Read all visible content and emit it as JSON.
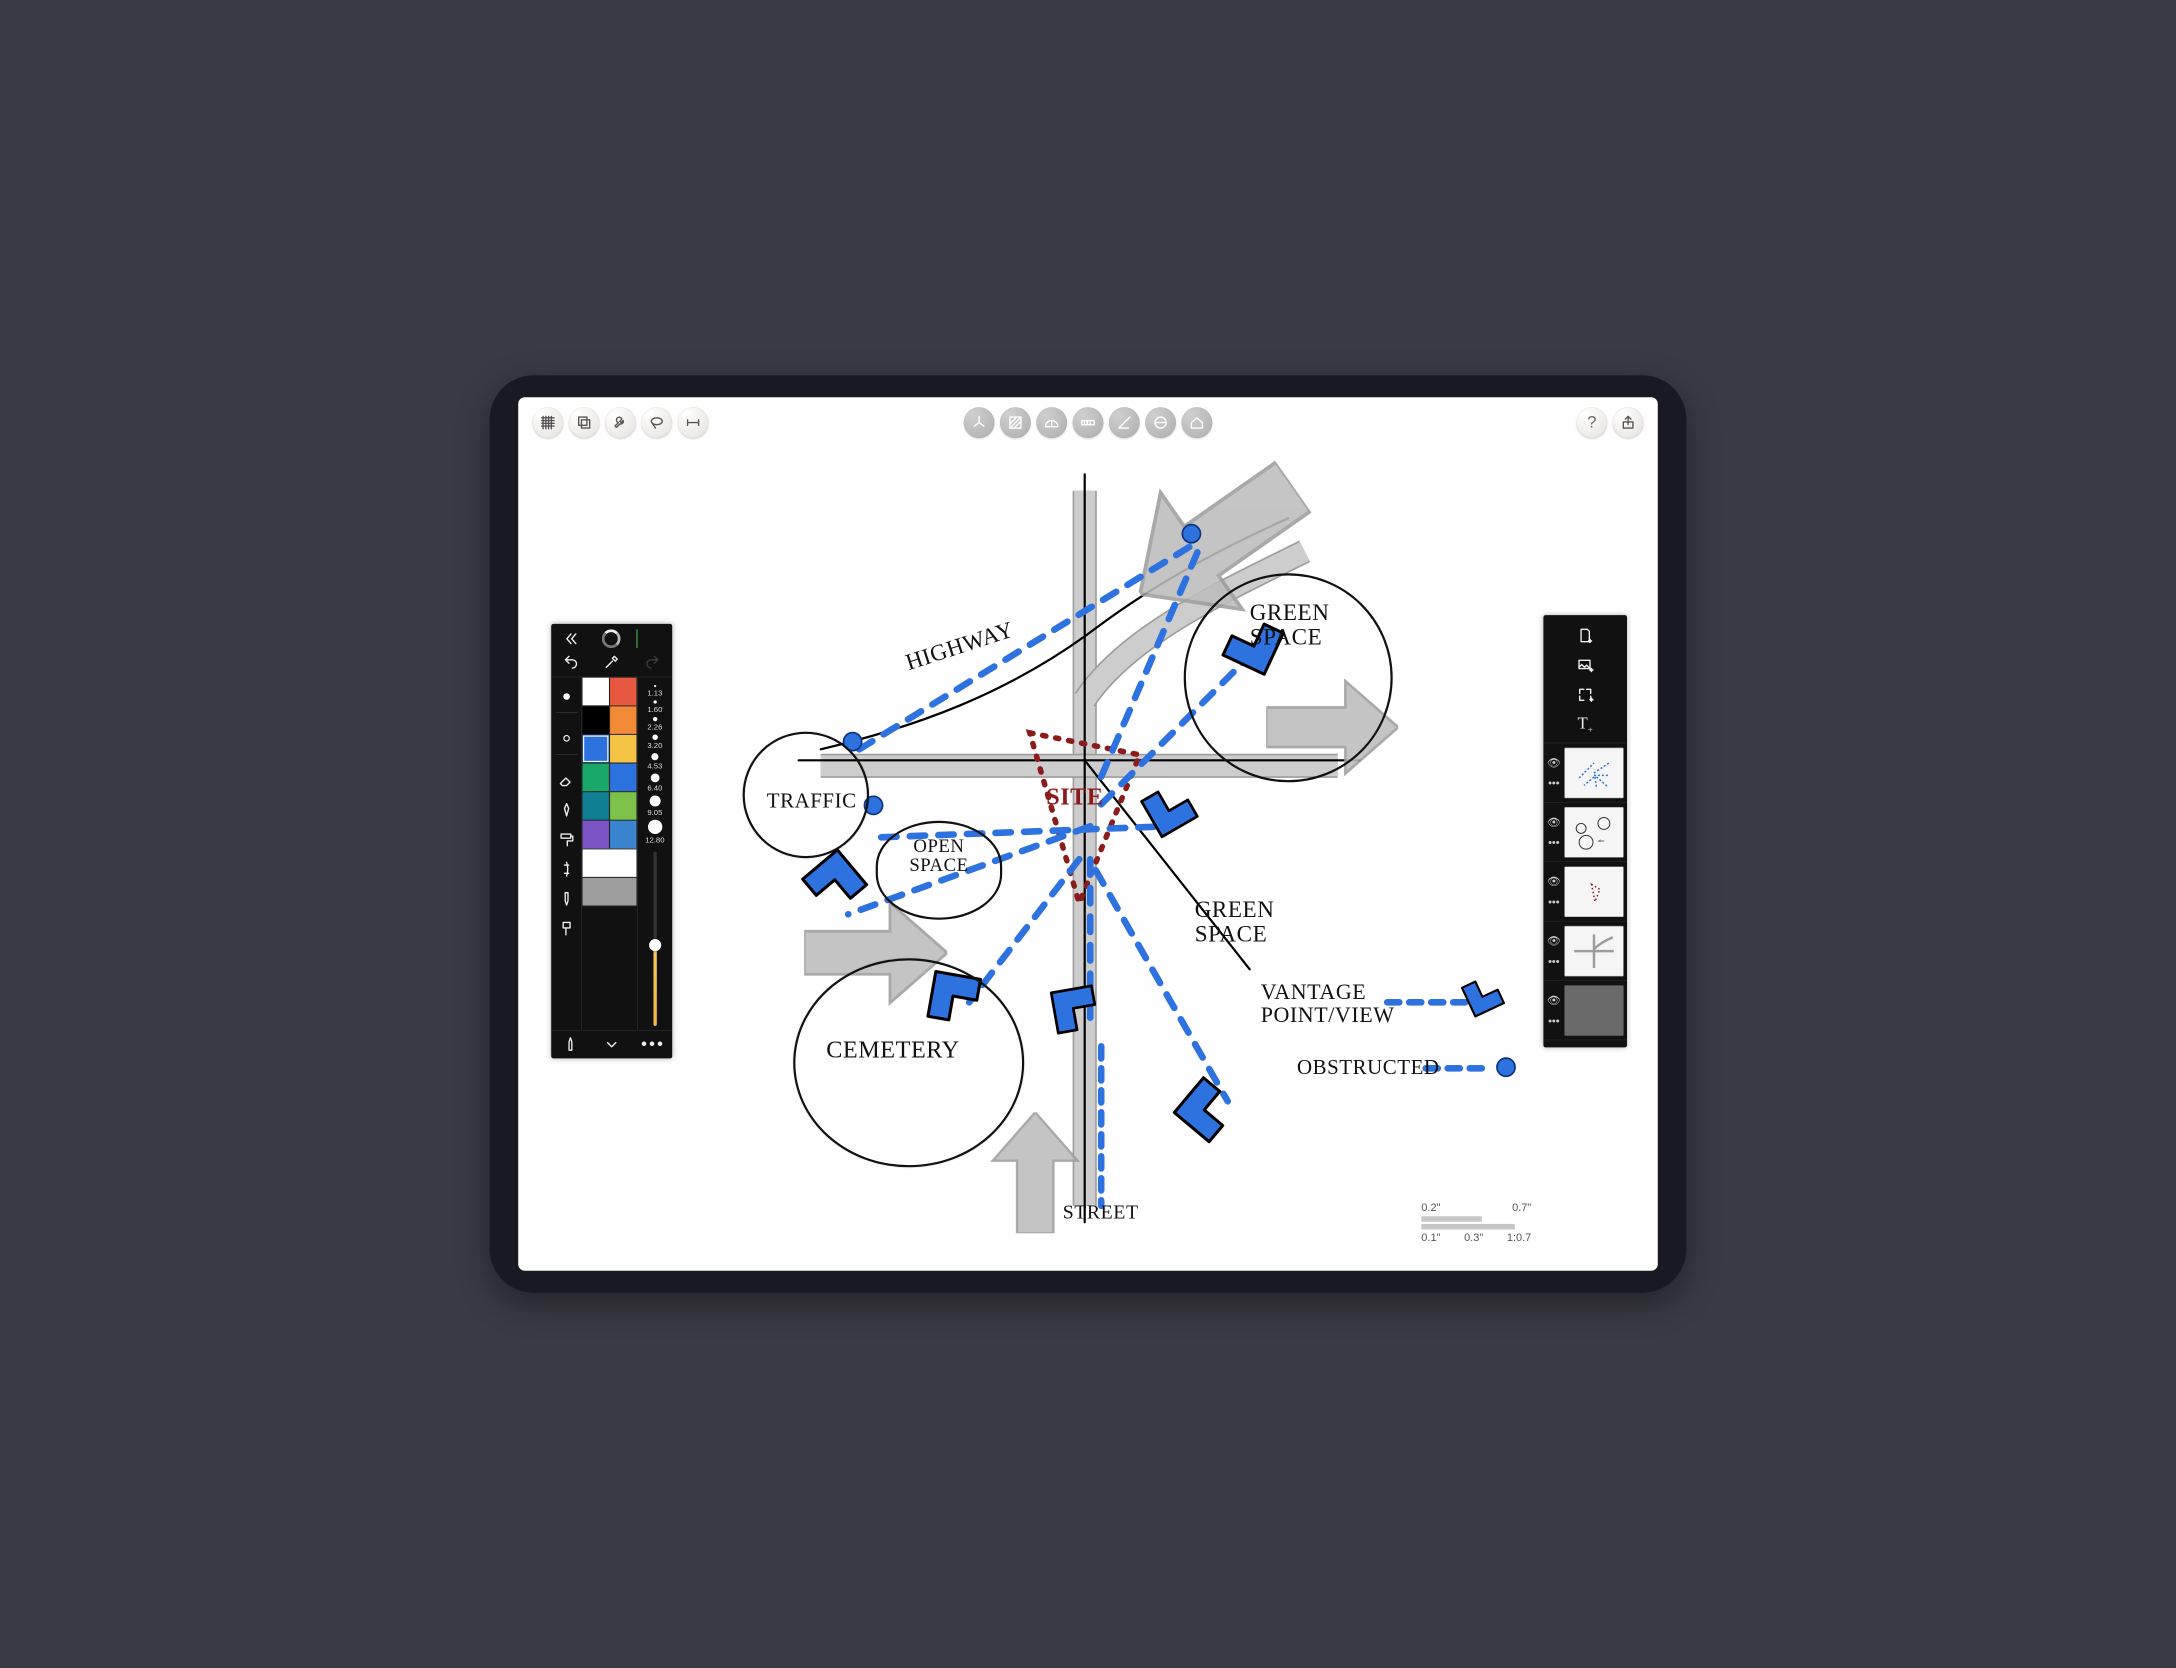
{
  "top_left_tools": [
    "grid",
    "layers",
    "wrench",
    "lasso",
    "measure"
  ],
  "top_center_tools": [
    "transform-3d",
    "hatch",
    "protractor",
    "ruler",
    "angle",
    "circle-dash",
    "house"
  ],
  "top_right_tools": [
    "help",
    "share"
  ],
  "brush_sizes": [
    "1.13",
    "1.60",
    "2.26",
    "3.20",
    "4.53",
    "6.40",
    "9.05",
    "12.80"
  ],
  "color_swatches": [
    "#ffffff",
    "#e8573f",
    "#000000",
    "#f08a36",
    "#2b72df",
    "#f6c445",
    "#1aa869",
    "#2b72df",
    "#0f7f93",
    "#7cc24a",
    "#7b54c6",
    "#3a84d0",
    "#ffffff",
    "#ffffff",
    "#9e9e9e",
    "#9e9e9e"
  ],
  "left_panel_tools": [
    "select",
    "eyedropper",
    "eraser",
    "pen",
    "pencil",
    "brush-flat",
    "calligraphy",
    "marker",
    "roller",
    "fine"
  ],
  "right_panel_top": [
    "add-page",
    "add-image",
    "add-frame",
    "add-text"
  ],
  "layers": [
    {
      "name": "layer-5",
      "visible": true
    },
    {
      "name": "layer-4",
      "visible": true
    },
    {
      "name": "layer-3",
      "visible": true
    },
    {
      "name": "layer-2",
      "visible": true
    },
    {
      "name": "layer-1",
      "visible": true,
      "empty": true
    }
  ],
  "sketch": {
    "labels": {
      "highway": "HIGHWAY",
      "traffic": "TRAFFIC",
      "open_space": "OPEN SPACE",
      "site": "SITE",
      "green_space_1": "GREEN SPACE",
      "green_space_2": "GREEN SPACE",
      "cemetery": "CEMETERY",
      "street": "STREET",
      "legend_vantage": "VANTAGE POINT/VIEW",
      "legend_obstructed": "OBSTRUCTED"
    }
  },
  "scale": {
    "top_left": "0.2\"",
    "top_right": "0.7\"",
    "bot_left": "0.1\"",
    "bot_mid": "0.3\"",
    "bot_right": "1:0.7"
  }
}
